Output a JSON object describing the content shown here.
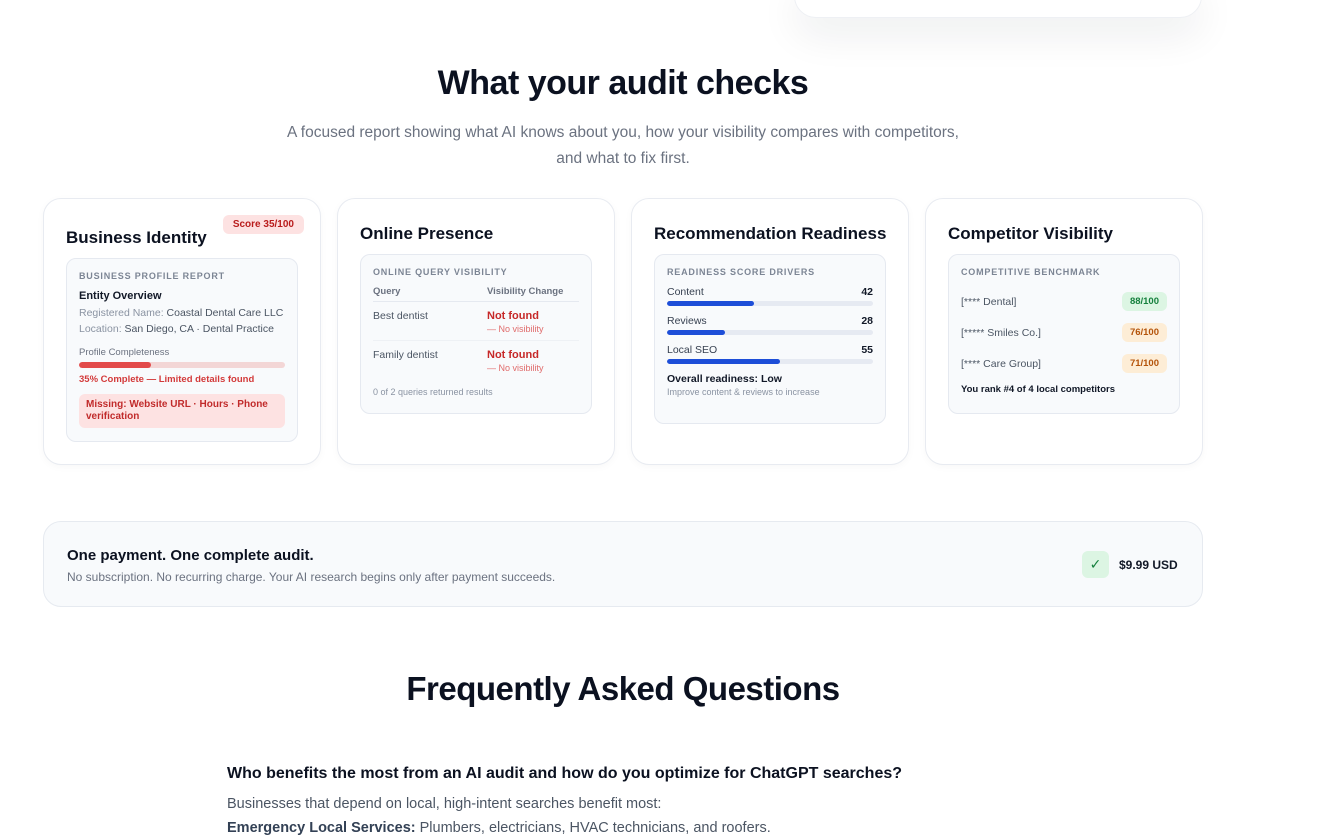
{
  "audit": {
    "title": "What your audit checks",
    "subtitle_line1": "A focused report showing what AI knows about you, how your visibility compares with competitors,",
    "subtitle_line2": "and what to fix first."
  },
  "cards": {
    "identity": {
      "title": "Business Identity",
      "score": "Score 35/100",
      "panel_label": "Business Profile Report",
      "entity_title": "Entity Overview",
      "registered_label": "Registered Name:",
      "registered_value": "Coastal Dental Care LLC",
      "location_label": "Location:",
      "location_value": "San Diego, CA · Dental Practice",
      "completeness_label": "Profile Completeness",
      "completeness_percent": 35,
      "completeness_text": "35% Complete — Limited details found",
      "missing": "Missing: Website URL · Hours · Phone verification"
    },
    "presence": {
      "title": "Online Presence",
      "panel_label": "Online Query Visibility",
      "col_query": "Query",
      "col_change": "Visibility Change",
      "rows": [
        {
          "query": "Best dentist",
          "status": "Not found",
          "note": "— No visibility"
        },
        {
          "query": "Family dentist",
          "status": "Not found",
          "note": "— No visibility"
        }
      ],
      "footer": "0 of 2 queries returned results"
    },
    "readiness": {
      "title": "Recommendation Readiness",
      "panel_label": "Readiness Score Drivers",
      "drivers": [
        {
          "label": "Content",
          "value": "42",
          "percent": 42
        },
        {
          "label": "Reviews",
          "value": "28",
          "percent": 28
        },
        {
          "label": "Local SEO",
          "value": "55",
          "percent": 55
        }
      ],
      "overall": "Overall readiness: Low",
      "improve": "Improve content & reviews to increase"
    },
    "competitor": {
      "title": "Competitor Visibility",
      "panel_label": "Competitive Benchmark",
      "rows": [
        {
          "name": "[**** Dental]",
          "score": "88/100",
          "bg": "#dcf5e3",
          "fg": "#15803d"
        },
        {
          "name": "[***** Smiles Co.]",
          "score": "76/100",
          "bg": "#fdedd6",
          "fg": "#b45309"
        },
        {
          "name": "[**** Care Group]",
          "score": "71/100",
          "bg": "#fdedd6",
          "fg": "#b45309"
        }
      ],
      "rank": "You rank #4 of 4 local competitors"
    }
  },
  "payment": {
    "title": "One payment. One complete audit.",
    "subtitle": "No subscription. No recurring charge. Your AI research begins only after payment succeeds.",
    "check": "✓",
    "price": "$9.99 USD"
  },
  "faq": {
    "title": "Frequently Asked Questions",
    "question": "Who benefits the most from an AI audit and how do you optimize for ChatGPT searches?",
    "answer_line1": "Businesses that depend on local, high-intent searches benefit most:",
    "answer_bold": "Emergency Local Services:",
    "answer_rest": " Plumbers, electricians, HVAC technicians, and roofers."
  }
}
